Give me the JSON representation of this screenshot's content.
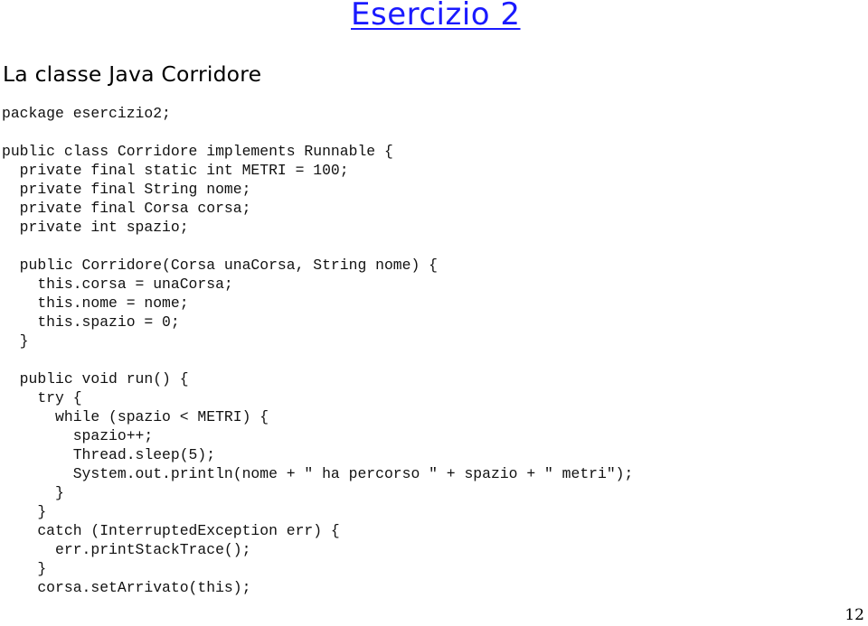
{
  "slide": {
    "title": "Esercizio 2",
    "title_color": "#1a1aff",
    "section_title": "La classe Java Corridore",
    "page_number": "12"
  },
  "code": {
    "lines": [
      "package esercizio2;",
      "",
      "public class Corridore implements Runnable {",
      "  private final static int METRI = 100;",
      "  private final String nome;",
      "  private final Corsa corsa;",
      "  private int spazio;",
      "",
      "  public Corridore(Corsa unaCorsa, String nome) {",
      "    this.corsa = unaCorsa;",
      "    this.nome = nome;",
      "    this.spazio = 0;",
      "  }",
      "",
      "  public void run() {",
      "    try {",
      "      while (spazio < METRI) {",
      "        spazio++;",
      "        Thread.sleep(5);",
      "        System.out.println(nome + \" ha percorso \" + spazio + \" metri\");",
      "      }",
      "    }",
      "    catch (InterruptedException err) {",
      "      err.printStackTrace();",
      "    }",
      "    corsa.setArrivato(this);"
    ]
  }
}
